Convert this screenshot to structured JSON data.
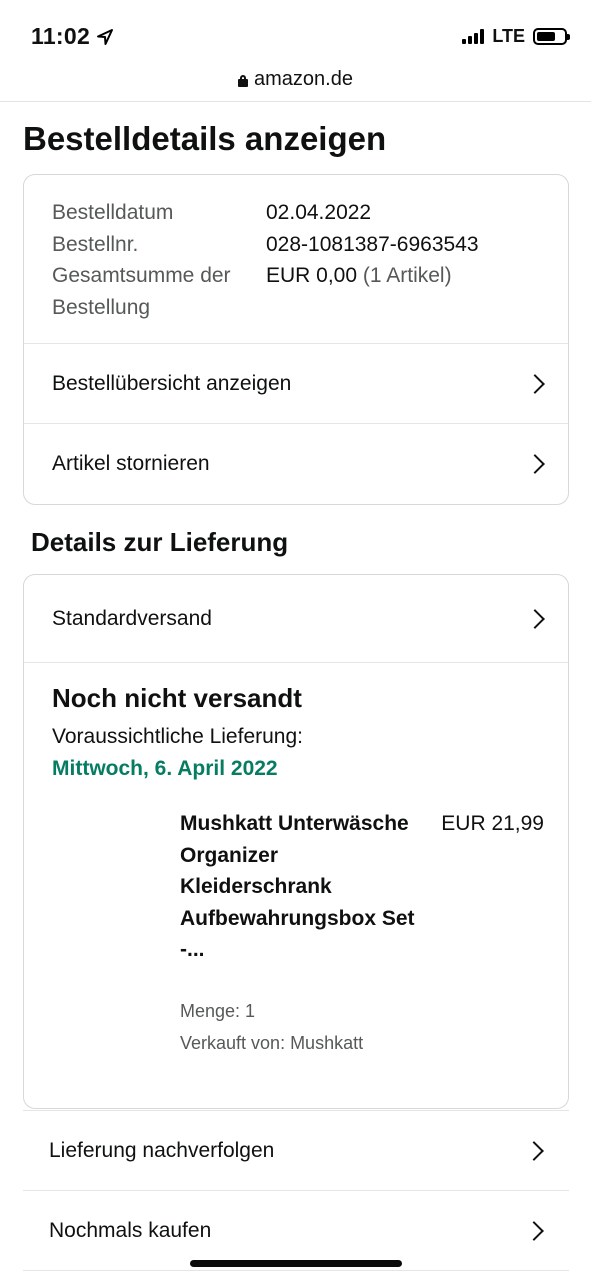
{
  "status_bar": {
    "time": "11:02",
    "network": "LTE"
  },
  "browser": {
    "url": "amazon.de"
  },
  "page": {
    "title": "Bestelldetails anzeigen"
  },
  "order_summary": {
    "rows": [
      {
        "label": "Bestelldatum",
        "value": "02.04.2022"
      },
      {
        "label": "Bestellnr.",
        "value": "028-1081387-6963543"
      },
      {
        "label": "Gesamtsumme der Bestellung",
        "value": "EUR 0,00",
        "extra": "(1 Artikel)"
      }
    ],
    "links": [
      {
        "label": "Bestellübersicht anzeigen"
      },
      {
        "label": "Artikel stornieren"
      }
    ]
  },
  "delivery": {
    "section_title": "Details zur Lieferung",
    "shipping_method": "Standardversand",
    "status": "Noch nicht versandt",
    "expected_label": "Voraussichtliche Lieferung:",
    "expected_date": "Mittwoch, 6. April 2022",
    "accent_color": "#067d62",
    "item": {
      "title": "Mushkatt Unterwäsche Organizer Kleiderschrank Aufbewahrungsbox Set -...",
      "price": "EUR 21,99",
      "quantity": "Menge: 1",
      "seller": "Verkauft von: Mushkatt"
    }
  },
  "actions": [
    {
      "label": "Lieferung nachverfolgen"
    },
    {
      "label": "Nochmals kaufen"
    }
  ],
  "icons": [
    "location-arrow-icon",
    "signal-icon",
    "battery-icon",
    "lock-icon",
    "chevron-right-icon"
  ]
}
